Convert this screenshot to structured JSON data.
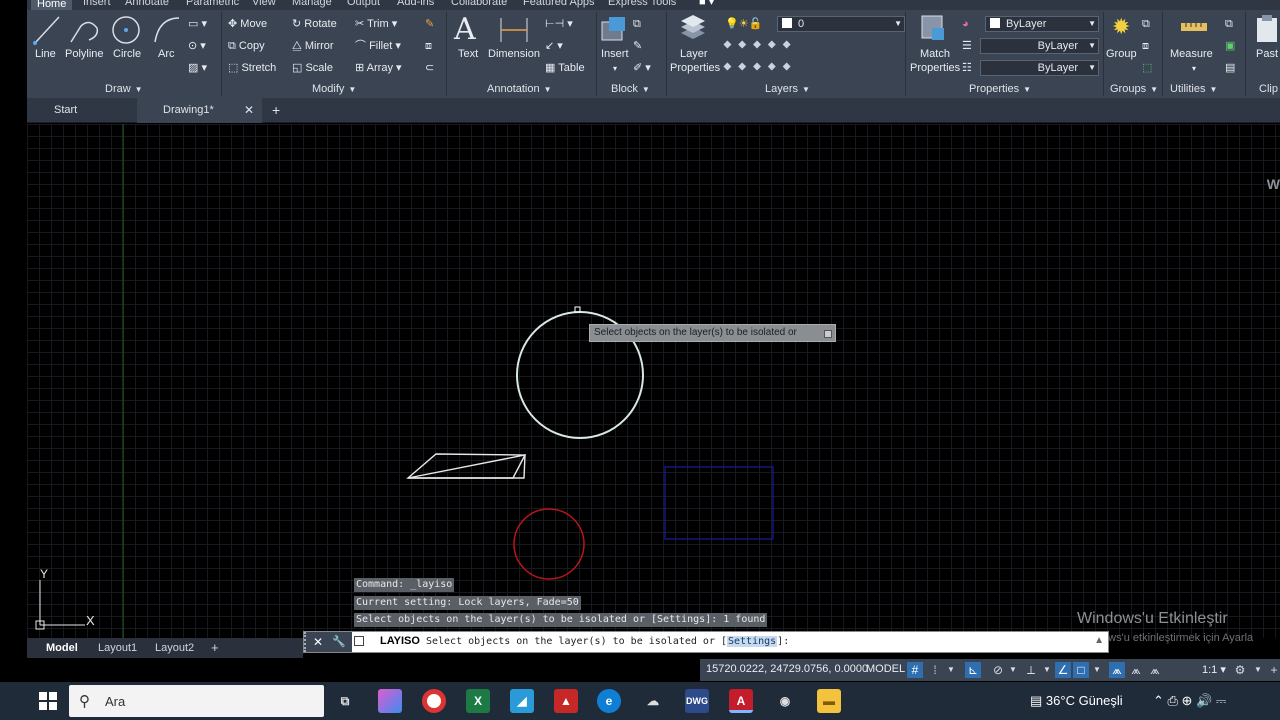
{
  "ribbon": {
    "tabs": [
      "Home",
      "Insert",
      "Annotate",
      "Parametric",
      "View",
      "Manage",
      "Output",
      "Add-ins",
      "Collaborate",
      "Featured Apps",
      "Express Tools"
    ],
    "draw": {
      "panel_label": "Draw",
      "line": "Line",
      "polyline": "Polyline",
      "circle": "Circle",
      "arc": "Arc"
    },
    "modify": {
      "panel_label": "Modify",
      "move": "Move",
      "rotate": "Rotate",
      "trim": "Trim",
      "copy": "Copy",
      "mirror": "Mirror",
      "fillet": "Fillet",
      "stretch": "Stretch",
      "scale": "Scale",
      "array": "Array"
    },
    "annotation": {
      "panel_label": "Annotation",
      "text": "Text",
      "dimension": "Dimension",
      "table": "Table"
    },
    "block": {
      "panel_label": "Block",
      "insert": "Insert"
    },
    "layers": {
      "panel_label": "Layers",
      "layer_properties_1": "Layer",
      "layer_properties_2": "Properties",
      "current_layer": "0"
    },
    "properties": {
      "panel_label": "Properties",
      "match_1": "Match",
      "match_2": "Properties",
      "color": "ByLayer",
      "linetype": "ByLayer",
      "lineweight": "ByLayer"
    },
    "groups": {
      "panel_label": "Groups",
      "group": "Group"
    },
    "utilities": {
      "panel_label": "Utilities",
      "measure": "Measure"
    },
    "clipboard": {
      "panel_label": "Clip",
      "paste": "Past"
    }
  },
  "doc_tabs": {
    "start": "Start",
    "drawing": "Drawing1*",
    "close": "✕",
    "add": "+"
  },
  "canvas": {
    "tooltip": "Select objects on the layer(s) to be isolated or",
    "ucs_y": "Y",
    "ucs_x": "X",
    "right_edge_letter": "W"
  },
  "command": {
    "history": [
      "Command: _layiso",
      "Current setting: Lock layers, Fade=50",
      "Select objects on the layer(s) to be isolated or [Settings]: 1 found"
    ],
    "prefix_close": "✕",
    "prefix_wrench": "🔧",
    "current_cmd": "LAYISO",
    "prompt": " Select objects on the layer(s) to be isolated or [",
    "option": "Settings",
    "suffix": "]:"
  },
  "watermark": {
    "title": "Windows'u Etkinleştir",
    "subtitle": "Windows'u etkinleştirmek için Ayarla"
  },
  "layout_tabs": {
    "model": "Model",
    "layout1": "Layout1",
    "layout2": "Layout2",
    "add": "+"
  },
  "status": {
    "coords": "15720.0222, 24729.0756, 0.0000",
    "mode": "MODEL",
    "scale": "1:1"
  },
  "taskbar": {
    "search_placeholder": "Ara",
    "weather": "36°C  Güneşli"
  },
  "colors": {
    "ribbon": "#3b4453",
    "accent": "#2f6fb0",
    "red_circle": "#b8161b",
    "blue_rect": "#1a1aa0"
  }
}
